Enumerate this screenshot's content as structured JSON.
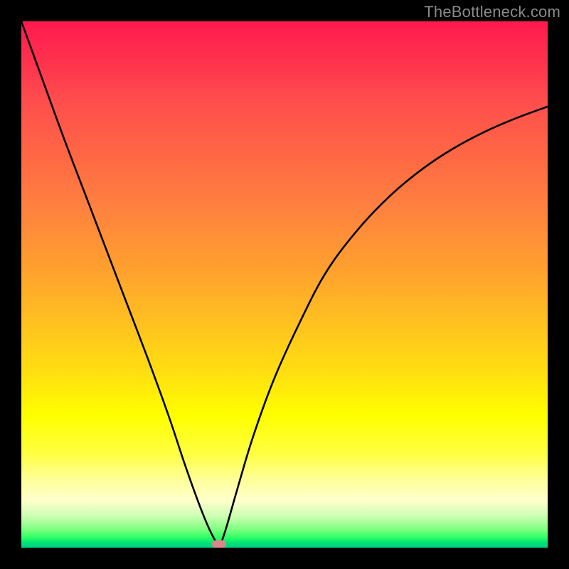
{
  "watermark": "TheBottleneck.com",
  "marker": {
    "x_pct": 37.5,
    "y_pct": 99.3
  },
  "colors": {
    "frame": "#000000",
    "curve": "#000000",
    "marker": "#d98888",
    "watermark": "#8a8a8a"
  },
  "chart_data": {
    "type": "line",
    "title": "",
    "xlabel": "",
    "ylabel": "",
    "xlim": [
      0,
      100
    ],
    "ylim": [
      0,
      100
    ],
    "grid": false,
    "legend": false,
    "series": [
      {
        "name": "bottleneck-curve",
        "x": [
          0,
          4,
          8,
          12,
          16,
          20,
          24,
          28,
          31,
          33.5,
          35.5,
          37,
          37.5,
          38,
          39,
          41,
          44,
          48,
          53,
          58,
          64,
          70,
          76,
          82,
          88,
          94,
          100
        ],
        "y": [
          100,
          89,
          78,
          67.5,
          57,
          46.5,
          36,
          25,
          16,
          9,
          4,
          1,
          0,
          1,
          4,
          11,
          21,
          32,
          43,
          52.5,
          60.5,
          66.8,
          71.8,
          75.8,
          79,
          81.6,
          83.8
        ]
      }
    ],
    "marker_point": {
      "x": 37.5,
      "y": 0
    },
    "note": "V-shaped bottleneck curve on rainbow gradient background; minimum near x≈37.5 where curve touches green zone. Values are percentage estimates read from the plot area (0–100 each axis, y=0 at bottom)."
  }
}
